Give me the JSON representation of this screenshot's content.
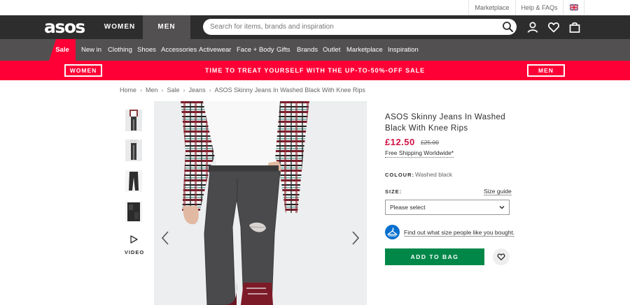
{
  "util": {
    "marketplace": "Marketplace",
    "help": "Help & FAQs",
    "flag_icon": "uk-flag-icon"
  },
  "header": {
    "logo": "asos",
    "tabs": [
      "WOMEN",
      "MEN"
    ],
    "active_tab": "MEN",
    "search_placeholder": "Search for items, brands and inspiration",
    "icons": [
      "search-icon",
      "account-icon",
      "heart-icon",
      "bag-icon"
    ]
  },
  "nav": {
    "sale": "Sale",
    "items": [
      "New in",
      "Clothing",
      "Shoes",
      "Accessories",
      "Activewear",
      "Face + Body",
      "Gifts",
      "Brands",
      "Outlet",
      "Marketplace",
      "Inspiration"
    ]
  },
  "promo": {
    "women": "WOMEN",
    "text": "TIME TO TREAT YOURSELF WITH THE UP-TO-50%-OFF SALE",
    "men": "MEN"
  },
  "breadcrumb": [
    "Home",
    "Men",
    "Sale",
    "Jeans",
    "ASOS Skinny Jeans In Washed Black With Knee Rips"
  ],
  "gallery": {
    "video_label": "VIDEO"
  },
  "product": {
    "title": "ASOS Skinny Jeans In Washed Black With Knee Rips",
    "price_now": "£12.50",
    "price_was": "£25.00",
    "free_shipping": "Free Shipping Worldwide*",
    "colour_label": "COLOUR:",
    "colour_value": "Washed black",
    "size_label": "SIZE:",
    "size_guide": "Size guide",
    "size_select_value": "Please select",
    "fit_link": "Find out what size people like you bought.",
    "add_to_bag": "ADD TO BAG"
  },
  "colors": {
    "header_bg": "#2d2d2d",
    "nav_bg": "#525050",
    "sale_red": "#ff0036",
    "price_red": "#d01345",
    "bag_green": "#018849",
    "fit_blue": "#0770cf"
  }
}
